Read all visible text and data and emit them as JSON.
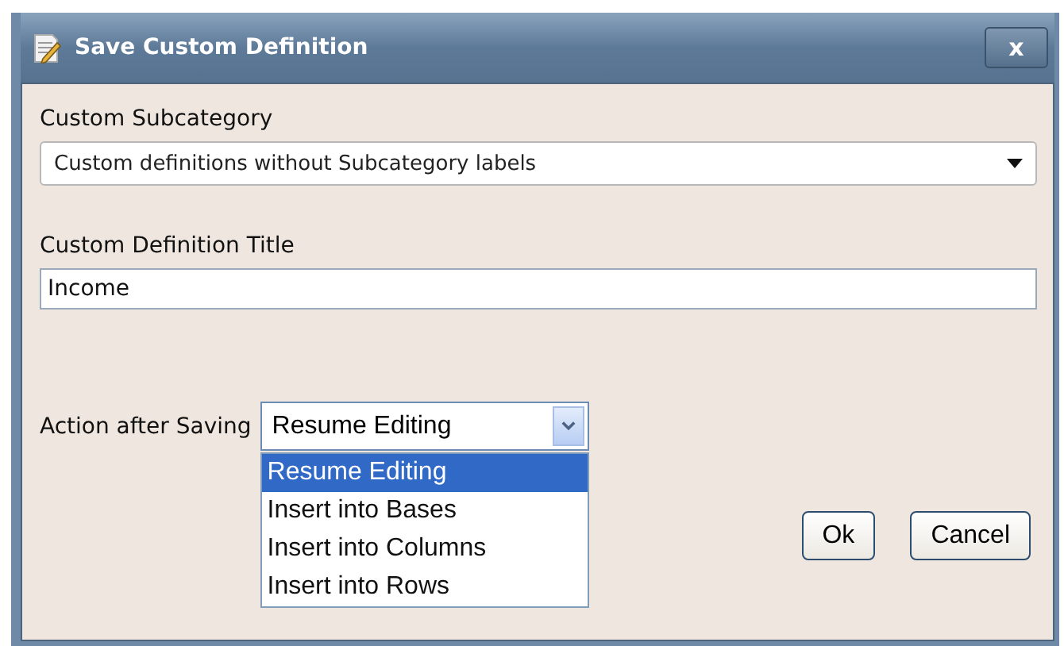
{
  "window": {
    "title": "Save Custom Definition",
    "close": "x"
  },
  "subcategory": {
    "label": "Custom Subcategory",
    "value": "Custom definitions without Subcategory labels"
  },
  "title_field": {
    "label": "Custom Definition Title",
    "value": "Income"
  },
  "action": {
    "label": "Action after Saving",
    "value": "Resume Editing",
    "expanded": true,
    "options": [
      {
        "label": "Resume Editing",
        "selected": true
      },
      {
        "label": "Insert into Bases",
        "selected": false
      },
      {
        "label": "Insert into Columns",
        "selected": false
      },
      {
        "label": "Insert into Rows",
        "selected": false
      }
    ]
  },
  "buttons": [
    "Ok",
    "Cancel"
  ]
}
